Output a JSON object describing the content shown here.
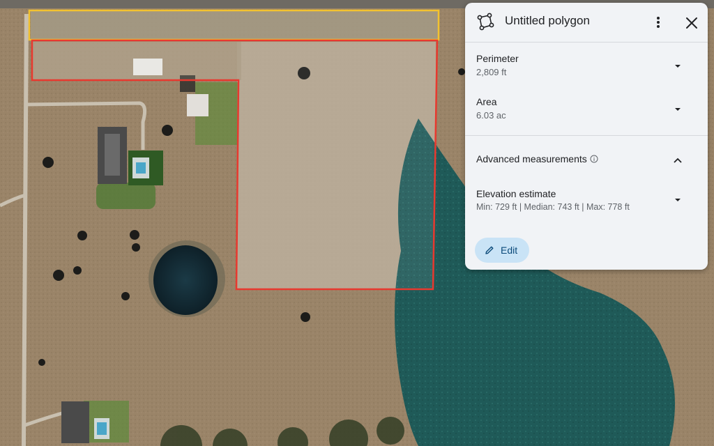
{
  "panel": {
    "title": "Untitled polygon",
    "perimeter": {
      "label": "Perimeter",
      "value": "2,809 ft"
    },
    "area": {
      "label": "Area",
      "value": "6.03 ac"
    },
    "advanced": {
      "label": "Advanced measurements"
    },
    "elevation": {
      "label": "Elevation estimate",
      "value": "Min: 729 ft | Median: 743 ft | Max: 778 ft"
    },
    "edit_label": "Edit"
  },
  "map": {
    "polygon_outline_color": "#e8392f",
    "parcel_outline_color": "#f2c230",
    "water_color": "#1f5a58"
  },
  "icons": {
    "title": "polygon-icon",
    "more": "more-vert-icon",
    "close": "close-icon",
    "chevron": "chevron-down-icon",
    "chevron_up": "chevron-up-icon",
    "info": "info-icon",
    "edit": "pencil-icon"
  }
}
